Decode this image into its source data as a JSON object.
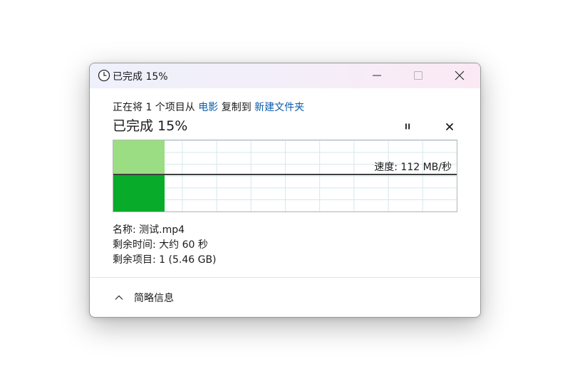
{
  "window": {
    "title": "已完成 15%"
  },
  "copy": {
    "desc_prefix": "正在将 1 个项目从 ",
    "source": "电影",
    "desc_middle": " 复制到 ",
    "destination": "新建文件夹",
    "status": "已完成 15%",
    "progress_percent": 15
  },
  "graph": {
    "speed_label": "速度: 112 MB/秒"
  },
  "details": {
    "name_line": "名称: 测试.mp4",
    "time_line": "剩余时间: 大约 60 秒",
    "items_line": "剩余项目: 1 (5.46 GB)"
  },
  "footer": {
    "toggle_label": "简略信息"
  },
  "colors": {
    "link": "#0b5cad",
    "progress_light": "#9bdd83",
    "progress_dark": "#08ab2a"
  }
}
